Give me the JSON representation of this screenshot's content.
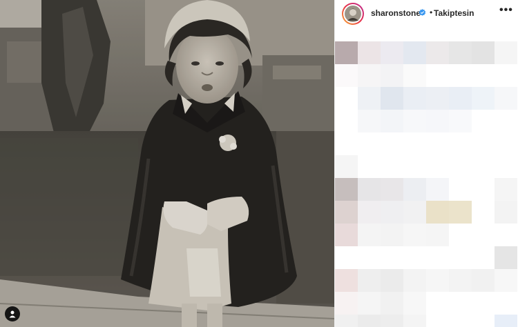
{
  "post": {
    "image": {
      "description_icon": "vintage-photo-child-in-cape",
      "tag_icon": "user-tag-icon"
    },
    "header": {
      "username": "sharonstone",
      "verified_icon": "verified-badge-icon",
      "separator": "•",
      "follow_status": "Takiptesin",
      "more_icon": "more-options-icon",
      "more_label": "•••"
    },
    "colors": {
      "verified": "#3897f0",
      "text": "#262626",
      "ring_start": "#f9b233",
      "ring_end": "#b82b97"
    },
    "caption_area": {
      "state": "pixelated"
    }
  }
}
